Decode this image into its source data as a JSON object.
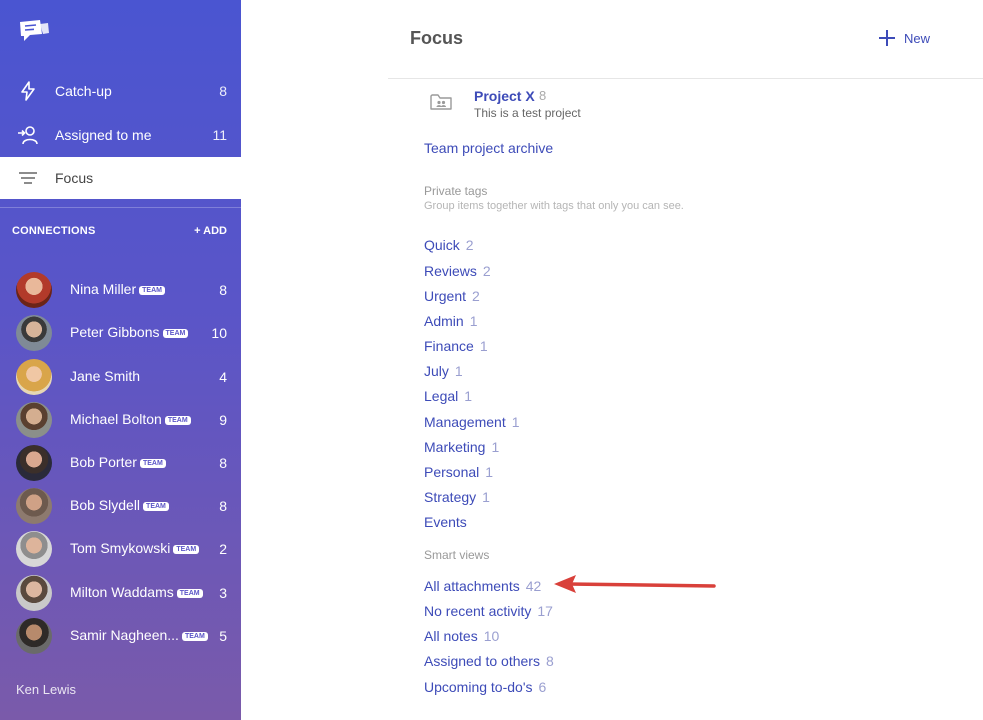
{
  "sidebar": {
    "nav": [
      {
        "label": "Catch-up",
        "count": "8",
        "icon": "lightning-icon"
      },
      {
        "label": "Assigned to me",
        "count": "11",
        "icon": "assigned-user-icon"
      },
      {
        "label": "Focus",
        "count": "",
        "icon": "menu-lines-icon"
      }
    ],
    "connections_label": "CONNECTIONS",
    "add_label": "+ ADD",
    "team_badge": "TEAM",
    "contacts": [
      {
        "name": "Nina Miller",
        "team": true,
        "count": "8"
      },
      {
        "name": "Peter Gibbons",
        "team": true,
        "count": "10"
      },
      {
        "name": "Jane Smith",
        "team": false,
        "count": "4"
      },
      {
        "name": "Michael Bolton",
        "team": true,
        "count": "9"
      },
      {
        "name": "Bob Porter",
        "team": true,
        "count": "8"
      },
      {
        "name": "Bob Slydell",
        "team": true,
        "count": "8"
      },
      {
        "name": "Tom Smykowski",
        "team": true,
        "count": "2"
      },
      {
        "name": "Milton Waddams",
        "team": true,
        "count": "3"
      },
      {
        "name": "Samir Nagheen...",
        "team": true,
        "count": "5"
      }
    ],
    "footer_user": "Ken Lewis"
  },
  "main": {
    "title": "Focus",
    "new_label": "New",
    "project": {
      "name": "Project X",
      "count": "8",
      "description": "This is a test project"
    },
    "archive_link": "Team project archive",
    "private_tags": {
      "title": "Private tags",
      "subtitle": "Group items together with tags that only you can see.",
      "items": [
        {
          "label": "Quick",
          "count": "2"
        },
        {
          "label": "Reviews",
          "count": "2"
        },
        {
          "label": "Urgent",
          "count": "2"
        },
        {
          "label": "Admin",
          "count": "1"
        },
        {
          "label": "Finance",
          "count": "1"
        },
        {
          "label": "July",
          "count": "1"
        },
        {
          "label": "Legal",
          "count": "1"
        },
        {
          "label": "Management",
          "count": "1"
        },
        {
          "label": "Marketing",
          "count": "1"
        },
        {
          "label": "Personal",
          "count": "1"
        },
        {
          "label": "Strategy",
          "count": "1"
        },
        {
          "label": "Events",
          "count": ""
        }
      ]
    },
    "smart_views": {
      "title": "Smart views",
      "items": [
        {
          "label": "All attachments",
          "count": "42"
        },
        {
          "label": "No recent activity",
          "count": "17"
        },
        {
          "label": "All notes",
          "count": "10"
        },
        {
          "label": "Assigned to others",
          "count": "8"
        },
        {
          "label": "Upcoming to-do's",
          "count": "6"
        }
      ]
    }
  },
  "colors": {
    "accent": "#3d4bb8",
    "sidebar_top": "#4a55d1",
    "sidebar_bottom": "#7a5aaa",
    "arrow": "#d9403a"
  }
}
